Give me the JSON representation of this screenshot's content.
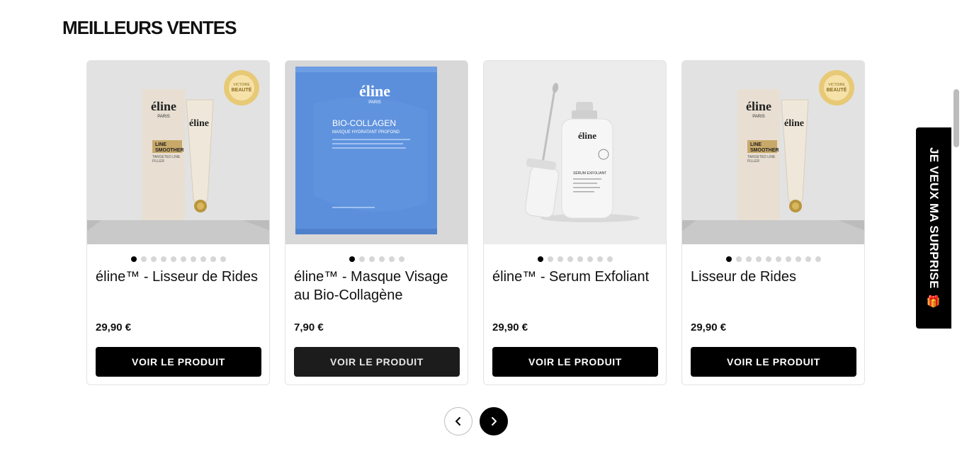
{
  "section": {
    "title": "MEILLEURS VENTES"
  },
  "products": [
    {
      "title": "éline™ - Lisseur de Rides",
      "price": "29,90 €",
      "button": "VOIR LE PRODUIT",
      "dots": 10,
      "active_dot": 0,
      "image": "line-smoother-product"
    },
    {
      "title": "éline™ - Masque Visage au Bio-Collagène",
      "price": "7,90 €",
      "button": "VOIR LE PRODUIT",
      "dots": 6,
      "active_dot": 0,
      "image": "bio-collagen-mask"
    },
    {
      "title": "éline™ - Serum Exfoliant",
      "price": "29,90 €",
      "button": "VOIR LE PRODUIT",
      "dots": 8,
      "active_dot": 0,
      "image": "exfoliating-serum-bottle"
    },
    {
      "title": "Lisseur de Rides",
      "price": "29,90 €",
      "button": "VOIR LE PRODUIT",
      "dots": 10,
      "active_dot": 0,
      "image": "line-smoother-product"
    }
  ],
  "carousel": {
    "prev_icon": "chevron-left-icon",
    "next_icon": "chevron-right-icon"
  },
  "side_tab": {
    "label": "JE VEUX MA SURPRISE",
    "icon": "gift-icon"
  },
  "image_text": {
    "brand": "éline",
    "city": "PARIS",
    "smoother_l1": "LINE",
    "smoother_l2": "SMOOTHER",
    "smoother_sub_l1": "TARGETED LINE",
    "smoother_sub_l2": "FILLER",
    "badge_l1": "VICTOIRE",
    "badge_l2": "BEAUTÉ",
    "mask_l1": "BIO-COLLAGEN",
    "mask_l2": "MASQUE HYDRATANT PROFOND",
    "serum_label": "SÉRUM EXFOLIANT"
  },
  "colors": {
    "accent": "#000000",
    "mask_blue": "#5b8fdc",
    "badge_gold": "#e8c76a"
  }
}
